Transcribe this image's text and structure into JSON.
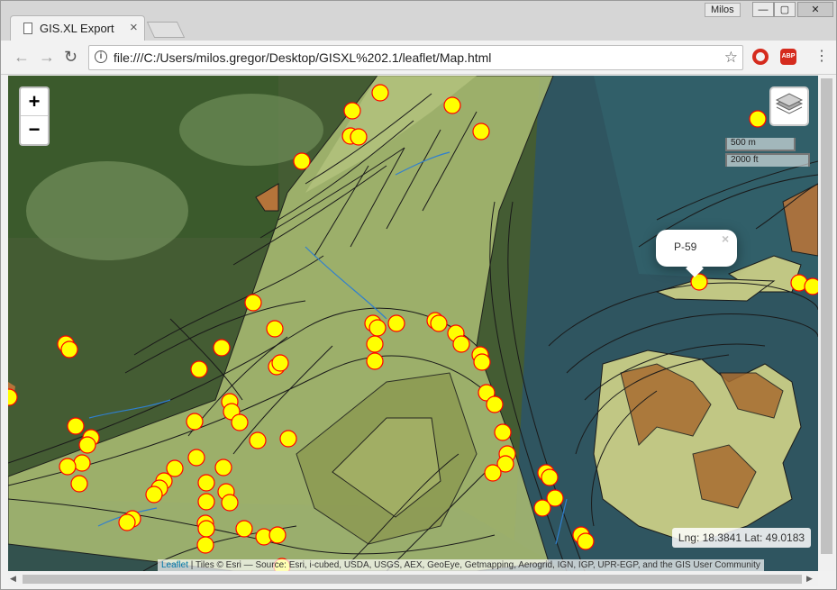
{
  "browser": {
    "tab_title": "GIS.XL Export",
    "tab_close": "×",
    "user_name": "Milos",
    "window_buttons": [
      "—",
      "▢",
      "✕"
    ],
    "url": "file:///C:/Users/milos.gregor/Desktop/GISXL%202.1/leaflet/Map.html",
    "back_icon": "←",
    "forward_icon": "→",
    "reload_icon": "↻",
    "info_icon": "i",
    "star_icon": "☆",
    "abp_label": "ABP",
    "menu_icon": "⋮"
  },
  "map": {
    "zoom_in": "+",
    "zoom_out": "−",
    "scale_metric": "500 m",
    "scale_imperial": "2000 ft",
    "popup_label": "P-59",
    "popup_close": "×",
    "coords_text": "Lng: 18.3841 Lat: 49.0183",
    "attribution_link": "Leaflet",
    "attribution_text": " | Tiles © Esri — Source: Esri, i-cubed, USDA, USGS, AEX, GeoEye, Getmapping, Aerogrid, IGN, IGP, UPR-EGP, and the GIS User Community",
    "marker_color": "#ffff00",
    "marker_stroke": "#ff0000",
    "polygon_fill": "#c8d68a",
    "brown_fill": "#b5743a"
  }
}
